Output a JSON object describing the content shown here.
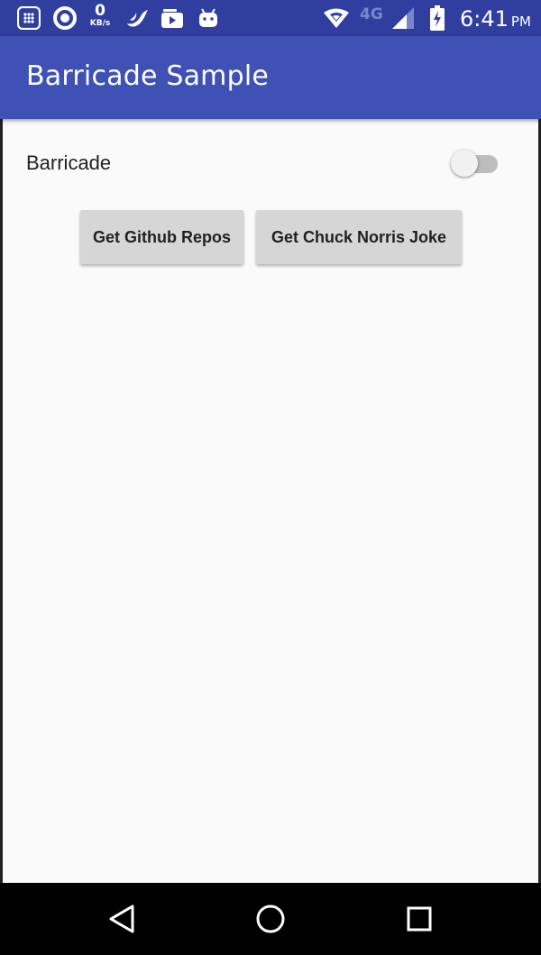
{
  "status_bar": {
    "data_rate_value": "0",
    "data_rate_unit": "KB/s",
    "network_type": "4G",
    "time": "6:41",
    "ampm": "PM",
    "icons": [
      "notification-grid-icon",
      "sync-ring-icon",
      "bird-app-icon",
      "video-app-icon",
      "android-app-icon",
      "wifi-icon",
      "signal-icon",
      "battery-charging-icon"
    ]
  },
  "app_bar": {
    "title": "Barricade Sample"
  },
  "main": {
    "barricade_label": "Barricade",
    "barricade_switch_on": false,
    "buttons": {
      "github": "Get Github Repos",
      "chuck": "Get Chuck Norris Joke"
    }
  },
  "nav_bar": {
    "icons": [
      "back-icon",
      "home-icon",
      "recents-icon"
    ]
  },
  "colors": {
    "status_bar": "#303f9f",
    "app_bar": "#3f51b5",
    "button_bg": "#d6d6d6",
    "background": "#fafafa"
  }
}
